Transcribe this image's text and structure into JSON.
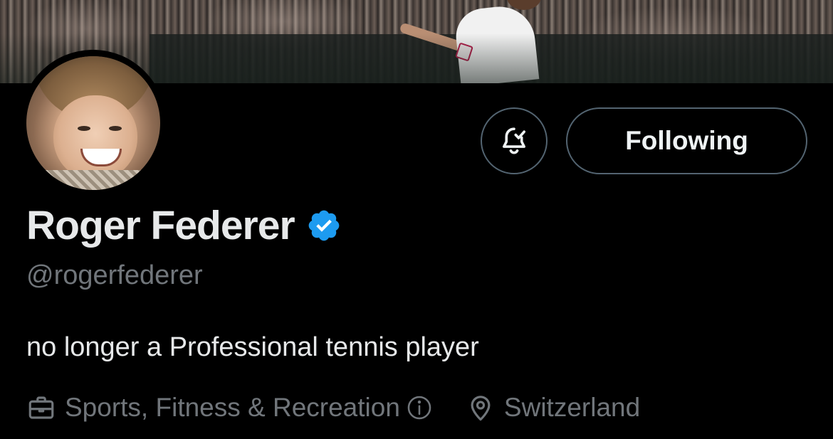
{
  "banner": {
    "alt": "Tennis player on court in front of crowd"
  },
  "profile": {
    "display_name": "Roger Federer",
    "handle": "@rogerfederer",
    "bio": "no longer a Professional tennis player",
    "verified_icon": "verified-badge-icon",
    "verified_color": "#1d9bf0"
  },
  "actions": {
    "notify_icon": "bell-check-icon",
    "following_label": "Following"
  },
  "meta": {
    "category": "Sports, Fitness & Recreation",
    "category_icon": "briefcase-icon",
    "info_icon": "info-icon",
    "location": "Switzerland",
    "location_icon": "location-pin-icon"
  },
  "colors": {
    "background": "#000000",
    "text_primary": "#e7e9ea",
    "text_secondary": "#71767b",
    "border": "#536471",
    "accent": "#1d9bf0"
  }
}
